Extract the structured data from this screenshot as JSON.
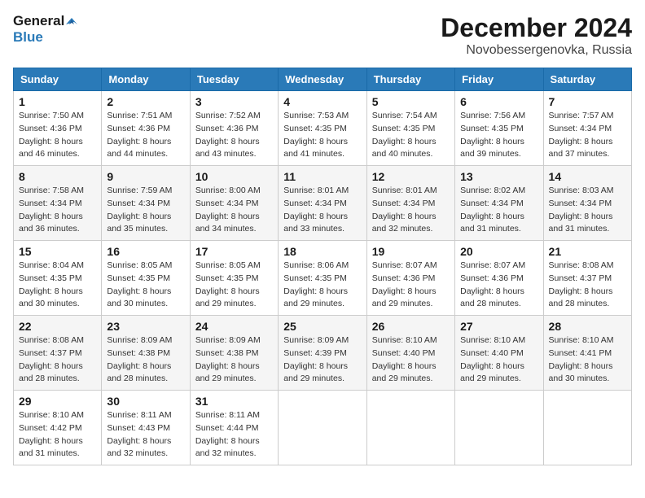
{
  "logo": {
    "line1": "General",
    "line2": "Blue"
  },
  "title": "December 2024",
  "location": "Novobessergenovka, Russia",
  "days_of_week": [
    "Sunday",
    "Monday",
    "Tuesday",
    "Wednesday",
    "Thursday",
    "Friday",
    "Saturday"
  ],
  "weeks": [
    [
      {
        "day": "1",
        "sunrise": "7:50 AM",
        "sunset": "4:36 PM",
        "daylight": "8 hours and 46 minutes."
      },
      {
        "day": "2",
        "sunrise": "7:51 AM",
        "sunset": "4:36 PM",
        "daylight": "8 hours and 44 minutes."
      },
      {
        "day": "3",
        "sunrise": "7:52 AM",
        "sunset": "4:36 PM",
        "daylight": "8 hours and 43 minutes."
      },
      {
        "day": "4",
        "sunrise": "7:53 AM",
        "sunset": "4:35 PM",
        "daylight": "8 hours and 41 minutes."
      },
      {
        "day": "5",
        "sunrise": "7:54 AM",
        "sunset": "4:35 PM",
        "daylight": "8 hours and 40 minutes."
      },
      {
        "day": "6",
        "sunrise": "7:56 AM",
        "sunset": "4:35 PM",
        "daylight": "8 hours and 39 minutes."
      },
      {
        "day": "7",
        "sunrise": "7:57 AM",
        "sunset": "4:34 PM",
        "daylight": "8 hours and 37 minutes."
      }
    ],
    [
      {
        "day": "8",
        "sunrise": "7:58 AM",
        "sunset": "4:34 PM",
        "daylight": "8 hours and 36 minutes."
      },
      {
        "day": "9",
        "sunrise": "7:59 AM",
        "sunset": "4:34 PM",
        "daylight": "8 hours and 35 minutes."
      },
      {
        "day": "10",
        "sunrise": "8:00 AM",
        "sunset": "4:34 PM",
        "daylight": "8 hours and 34 minutes."
      },
      {
        "day": "11",
        "sunrise": "8:01 AM",
        "sunset": "4:34 PM",
        "daylight": "8 hours and 33 minutes."
      },
      {
        "day": "12",
        "sunrise": "8:01 AM",
        "sunset": "4:34 PM",
        "daylight": "8 hours and 32 minutes."
      },
      {
        "day": "13",
        "sunrise": "8:02 AM",
        "sunset": "4:34 PM",
        "daylight": "8 hours and 31 minutes."
      },
      {
        "day": "14",
        "sunrise": "8:03 AM",
        "sunset": "4:34 PM",
        "daylight": "8 hours and 31 minutes."
      }
    ],
    [
      {
        "day": "15",
        "sunrise": "8:04 AM",
        "sunset": "4:35 PM",
        "daylight": "8 hours and 30 minutes."
      },
      {
        "day": "16",
        "sunrise": "8:05 AM",
        "sunset": "4:35 PM",
        "daylight": "8 hours and 30 minutes."
      },
      {
        "day": "17",
        "sunrise": "8:05 AM",
        "sunset": "4:35 PM",
        "daylight": "8 hours and 29 minutes."
      },
      {
        "day": "18",
        "sunrise": "8:06 AM",
        "sunset": "4:35 PM",
        "daylight": "8 hours and 29 minutes."
      },
      {
        "day": "19",
        "sunrise": "8:07 AM",
        "sunset": "4:36 PM",
        "daylight": "8 hours and 29 minutes."
      },
      {
        "day": "20",
        "sunrise": "8:07 AM",
        "sunset": "4:36 PM",
        "daylight": "8 hours and 28 minutes."
      },
      {
        "day": "21",
        "sunrise": "8:08 AM",
        "sunset": "4:37 PM",
        "daylight": "8 hours and 28 minutes."
      }
    ],
    [
      {
        "day": "22",
        "sunrise": "8:08 AM",
        "sunset": "4:37 PM",
        "daylight": "8 hours and 28 minutes."
      },
      {
        "day": "23",
        "sunrise": "8:09 AM",
        "sunset": "4:38 PM",
        "daylight": "8 hours and 28 minutes."
      },
      {
        "day": "24",
        "sunrise": "8:09 AM",
        "sunset": "4:38 PM",
        "daylight": "8 hours and 29 minutes."
      },
      {
        "day": "25",
        "sunrise": "8:09 AM",
        "sunset": "4:39 PM",
        "daylight": "8 hours and 29 minutes."
      },
      {
        "day": "26",
        "sunrise": "8:10 AM",
        "sunset": "4:40 PM",
        "daylight": "8 hours and 29 minutes."
      },
      {
        "day": "27",
        "sunrise": "8:10 AM",
        "sunset": "4:40 PM",
        "daylight": "8 hours and 29 minutes."
      },
      {
        "day": "28",
        "sunrise": "8:10 AM",
        "sunset": "4:41 PM",
        "daylight": "8 hours and 30 minutes."
      }
    ],
    [
      {
        "day": "29",
        "sunrise": "8:10 AM",
        "sunset": "4:42 PM",
        "daylight": "8 hours and 31 minutes."
      },
      {
        "day": "30",
        "sunrise": "8:11 AM",
        "sunset": "4:43 PM",
        "daylight": "8 hours and 32 minutes."
      },
      {
        "day": "31",
        "sunrise": "8:11 AM",
        "sunset": "4:44 PM",
        "daylight": "8 hours and 32 minutes."
      },
      null,
      null,
      null,
      null
    ]
  ],
  "labels": {
    "sunrise_prefix": "Sunrise: ",
    "sunset_prefix": "Sunset: ",
    "daylight_prefix": "Daylight: "
  }
}
